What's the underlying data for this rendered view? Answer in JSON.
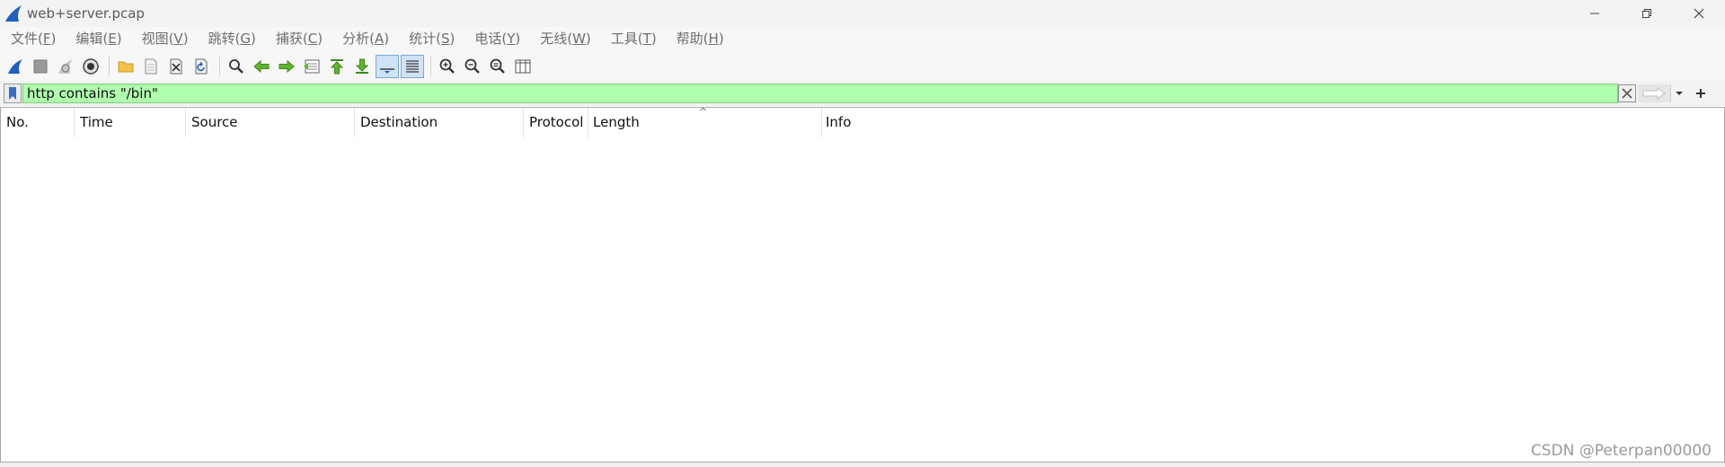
{
  "window": {
    "title": "web+server.pcap"
  },
  "menu": [
    {
      "label": "文件(",
      "key": "F",
      "end": ")"
    },
    {
      "label": "编辑(",
      "key": "E",
      "end": ")"
    },
    {
      "label": "视图(",
      "key": "V",
      "end": ")"
    },
    {
      "label": "跳转(",
      "key": "G",
      "end": ")"
    },
    {
      "label": "捕获(",
      "key": "C",
      "end": ")"
    },
    {
      "label": "分析(",
      "key": "A",
      "end": ")"
    },
    {
      "label": "统计(",
      "key": "S",
      "end": ")"
    },
    {
      "label": "电话(",
      "key": "Y",
      "end": ")"
    },
    {
      "label": "无线(",
      "key": "W",
      "end": ")"
    },
    {
      "label": "工具(",
      "key": "T",
      "end": ")"
    },
    {
      "label": "帮助(",
      "key": "H",
      "end": ")"
    }
  ],
  "filter": {
    "value": "http contains \"/bin\"",
    "colors": {
      "valid_bg": "#afffaf"
    }
  },
  "columns": [
    "No.",
    "Time",
    "Source",
    "Destination",
    "Protocol",
    "Length",
    "Info"
  ],
  "watermark": "CSDN @Peterpan00000",
  "colors": {
    "shark_blue": "#1f5fbf",
    "arrow_green": "#5fb52f"
  }
}
